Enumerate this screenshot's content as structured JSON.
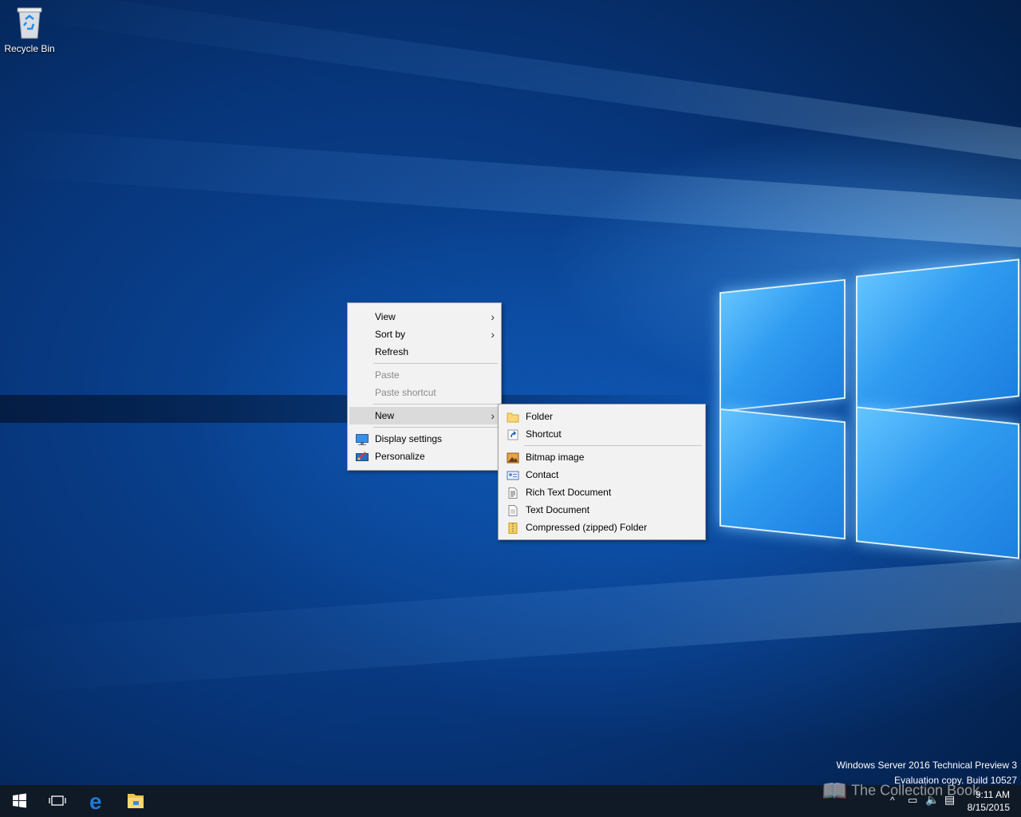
{
  "desktop": {
    "icons": [
      {
        "label": "Recycle Bin",
        "icon": "recycle-bin-icon"
      }
    ],
    "watermark": {
      "line1": "Windows Server 2016 Technical Preview 3",
      "line2": "Evaluation copy. Build 10527"
    },
    "site_mark": "The Collection Book"
  },
  "context_menu": {
    "items": [
      {
        "label": "View",
        "submenu": true
      },
      {
        "label": "Sort by",
        "submenu": true
      },
      {
        "label": "Refresh"
      },
      {
        "label": "Paste",
        "disabled": true
      },
      {
        "label": "Paste shortcut",
        "disabled": true
      },
      {
        "label": "New",
        "submenu": true,
        "highlighted": true
      },
      {
        "label": "Display settings",
        "icon": "display-settings-icon"
      },
      {
        "label": "Personalize",
        "icon": "personalize-icon"
      }
    ]
  },
  "new_submenu": {
    "items": [
      {
        "label": "Folder",
        "icon": "folder-icon"
      },
      {
        "label": "Shortcut",
        "icon": "shortcut-icon"
      },
      {
        "label": "Bitmap image",
        "icon": "bitmap-icon"
      },
      {
        "label": "Contact",
        "icon": "contact-icon"
      },
      {
        "label": "Rich Text Document",
        "icon": "rich-text-icon"
      },
      {
        "label": "Text Document",
        "icon": "text-document-icon"
      },
      {
        "label": "Compressed (zipped) Folder",
        "icon": "zip-folder-icon"
      }
    ]
  },
  "taskbar": {
    "buttons": [
      "start-icon",
      "task-view-icon",
      "edge-icon",
      "file-explorer-icon"
    ],
    "clock": {
      "time": "9:11 AM",
      "date": "8/15/2015"
    }
  },
  "colors": {
    "taskbar": "#101a26",
    "menu_bg": "#f2f2f2",
    "highlight": "#dadada"
  }
}
